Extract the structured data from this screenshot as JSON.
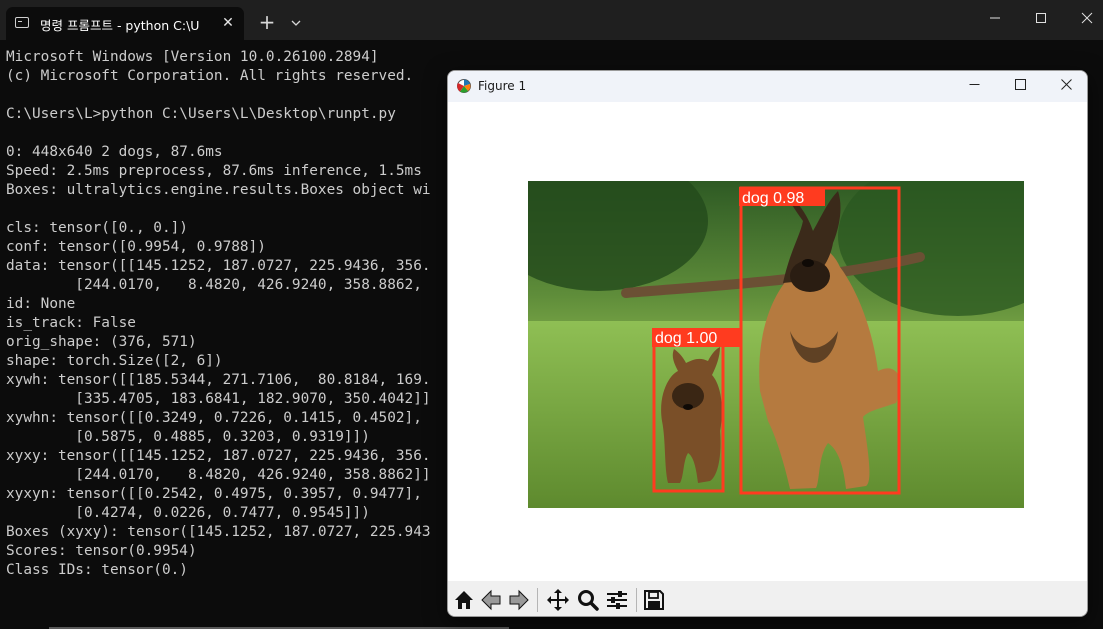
{
  "terminal": {
    "tab_title": "명령 프롬프트 - python  C:\\U",
    "close_glyph": "✕",
    "new_tab_glyph": "+",
    "dropdown_glyph": "⌄",
    "window_controls": {
      "minimize": "—",
      "maximize": "☐",
      "close": "✕"
    },
    "lines": [
      "Microsoft Windows [Version 10.0.26100.2894]",
      "(c) Microsoft Corporation. All rights reserved.",
      "",
      "C:\\Users\\L>python C:\\Users\\L\\Desktop\\runpt.py",
      "",
      "0: 448x640 2 dogs, 87.6ms",
      "Speed: 2.5ms preprocess, 87.6ms inference, 1.5ms",
      "Boxes: ultralytics.engine.results.Boxes object wi",
      "",
      "cls: tensor([0., 0.])",
      "conf: tensor([0.9954, 0.9788])",
      "data: tensor([[145.1252, 187.0727, 225.9436, 356.",
      "        [244.0170,   8.4820, 426.9240, 358.8862,",
      "id: None",
      "is_track: False",
      "orig_shape: (376, 571)",
      "shape: torch.Size([2, 6])",
      "xywh: tensor([[185.5344, 271.7106,  80.8184, 169.",
      "        [335.4705, 183.6841, 182.9070, 350.4042]]",
      "xywhn: tensor([[0.3249, 0.7226, 0.1415, 0.4502],",
      "        [0.5875, 0.4885, 0.3203, 0.9319]])",
      "xyxy: tensor([[145.1252, 187.0727, 225.9436, 356.",
      "        [244.0170,   8.4820, 426.9240, 358.8862]]",
      "xyxyn: tensor([[0.2542, 0.4975, 0.3957, 0.9477],",
      "        [0.4274, 0.0226, 0.7477, 0.9545]])",
      "Boxes (xyxy): tensor([145.1252, 187.0727, 225.943",
      "Scores: tensor(0.9954)",
      "Class IDs: tensor(0.)"
    ]
  },
  "figure": {
    "title": "Figure 1",
    "window_controls": {
      "minimize": "—",
      "maximize": "☐",
      "close": "✕"
    },
    "detections": [
      {
        "label": "dog 0.98",
        "color": "#ff3b1f"
      },
      {
        "label": "dog 1.00",
        "color": "#ff3b1f"
      }
    ],
    "toolbar": [
      "home-icon",
      "back-icon",
      "forward-icon",
      "pan-icon",
      "zoom-icon",
      "configure-subplots-icon",
      "save-icon"
    ]
  },
  "colors": {
    "terminal_bg": "#0c0c0c",
    "terminal_text": "#cccccc",
    "titlebar": "#1f1f1f",
    "box": "#ff3b1f"
  }
}
